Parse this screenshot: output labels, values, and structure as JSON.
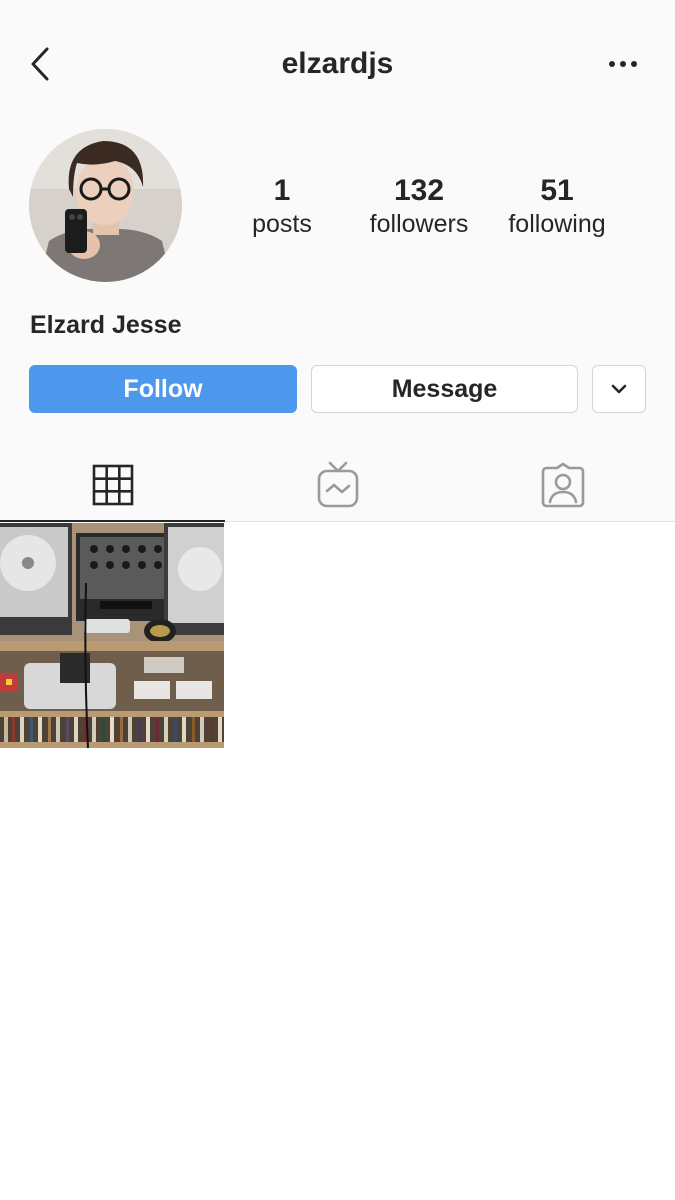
{
  "header": {
    "username": "elzardjs",
    "back_icon": "chevron-left-icon",
    "more_icon": "more-horizontal-icon"
  },
  "profile": {
    "full_name": "Elzard Jesse",
    "avatar_description": "profile-photo",
    "stats": {
      "posts": {
        "value": "1",
        "label": "posts"
      },
      "followers": {
        "value": "132",
        "label": "followers"
      },
      "following": {
        "value": "51",
        "label": "following"
      }
    }
  },
  "actions": {
    "follow_label": "Follow",
    "message_label": "Message",
    "dropdown_icon": "chevron-down-icon"
  },
  "tabs": [
    {
      "name": "posts-grid",
      "icon": "grid-icon",
      "active": true
    },
    {
      "name": "igtv",
      "icon": "igtv-icon",
      "active": false
    },
    {
      "name": "tagged",
      "icon": "tagged-user-icon",
      "active": false
    }
  ],
  "posts": [
    {
      "description": "dj-setup-turntables-mixer-records"
    }
  ],
  "colors": {
    "follow_button": "#4d98ec",
    "background": "#fafafa",
    "text": "#262626",
    "border": "#d4d4d4"
  }
}
